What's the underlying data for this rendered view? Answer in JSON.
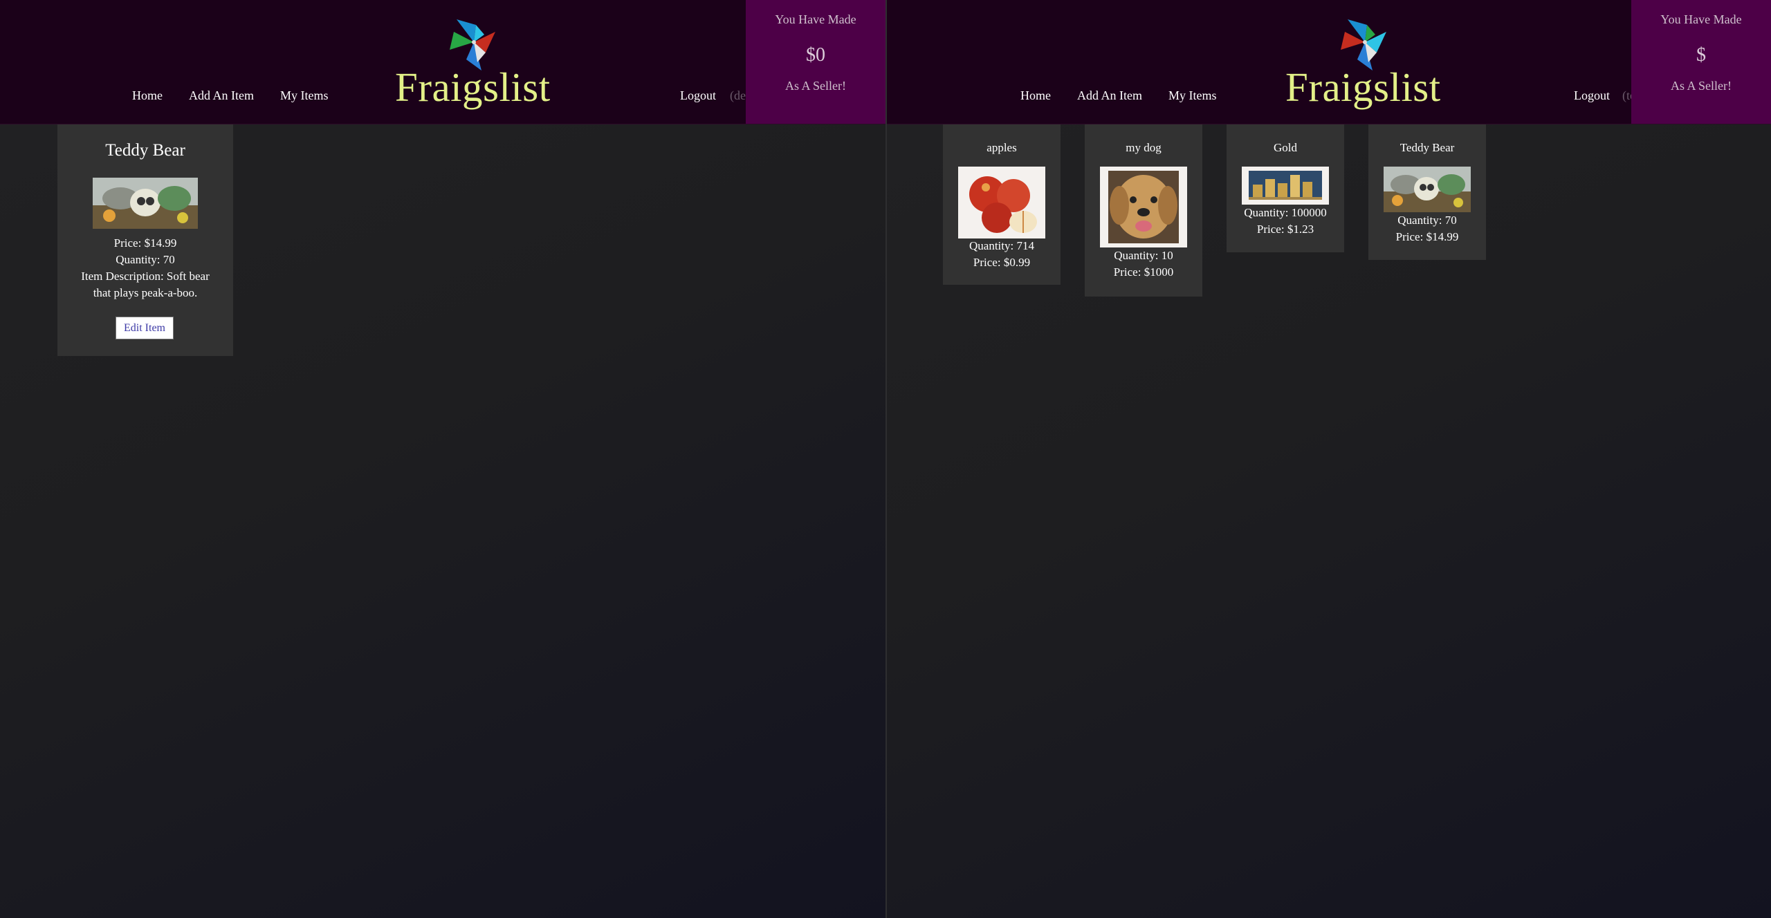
{
  "left": {
    "brand": "Fraigslist",
    "nav": {
      "home": "Home",
      "add": "Add An Item",
      "mine": "My Items",
      "logout": "Logout",
      "user": "(demo)"
    },
    "earnings": {
      "line1": "You Have Made",
      "amount": "$0",
      "line3": "As A Seller!"
    },
    "item": {
      "title": "Teddy Bear",
      "price": "Price: $14.99",
      "quantity": "Quantity: 70",
      "description": "Item Description: Soft bear that plays peak-a-boo.",
      "edit": "Edit Item"
    }
  },
  "right": {
    "brand": "Fraigslist",
    "nav": {
      "home": "Home",
      "add": "Add An Item",
      "mine": "My Items",
      "logout": "Logout",
      "user": "(test)"
    },
    "earnings": {
      "line1": "You Have Made",
      "amount": "$",
      "line3": "As A Seller!"
    },
    "items": [
      {
        "title": "apples",
        "quantity": "Quantity: 714",
        "price": "Price: $0.99"
      },
      {
        "title": "my dog",
        "quantity": "Quantity: 10",
        "price": "Price: $1000"
      },
      {
        "title": "Gold",
        "quantity": "Quantity: 100000",
        "price": "Price: $1.23"
      },
      {
        "title": "Teddy Bear",
        "quantity": "Quantity: 70",
        "price": "Price: $14.99"
      }
    ]
  },
  "colors": {
    "header": "#1b0119",
    "earnings": "#4d0047",
    "brand": "#e3f088",
    "card": "#323232"
  }
}
